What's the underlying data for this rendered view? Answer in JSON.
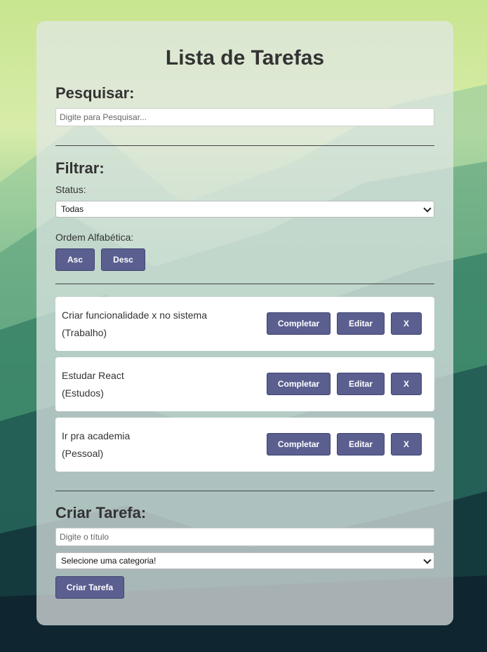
{
  "app": {
    "title": "Lista de Tarefas"
  },
  "search": {
    "heading": "Pesquisar:",
    "placeholder": "Digite para Pesquisar..."
  },
  "filter": {
    "heading": "Filtrar:",
    "status_label": "Status:",
    "status_selected": "Todas",
    "order_label": "Ordem Alfabética:",
    "asc_label": "Asc",
    "desc_label": "Desc"
  },
  "tasks": [
    {
      "title": "Criar funcionalidade x no sistema",
      "category": "(Trabalho)"
    },
    {
      "title": "Estudar React",
      "category": "(Estudos)"
    },
    {
      "title": "Ir pra academia",
      "category": "(Pessoal)"
    }
  ],
  "task_actions": {
    "complete_label": "Completar",
    "edit_label": "Editar",
    "delete_label": "X"
  },
  "create": {
    "heading": "Criar Tarefa:",
    "title_placeholder": "Digite o título",
    "category_selected": "Selecione uma categoria!",
    "submit_label": "Criar Tarefa"
  },
  "colors": {
    "button": "#5b5f8f",
    "card": "#e2e8e8"
  }
}
